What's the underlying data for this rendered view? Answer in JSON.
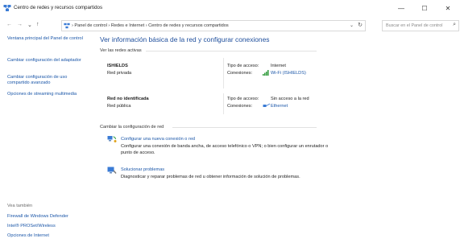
{
  "window": {
    "title": "Centro de redes y recursos compartidos",
    "minimize": "—",
    "maximize": "☐",
    "close": "✕"
  },
  "nav": {
    "back": "←",
    "forward": "→",
    "up": "↑",
    "breadcrumb": "›  Panel de control  ›  Redes e Internet  ›  Centro de redes y recursos compartidos",
    "dropdown": "⌄",
    "refresh": "↻",
    "search_placeholder": "Buscar en el Panel de control",
    "search_icon": "⌕"
  },
  "sidebar": {
    "links": [
      "Ventana principal del Panel de control",
      "Cambiar configuración del adaptador",
      "Cambiar configuración de uso compartido avanzado",
      "Opciones de streaming multimedia"
    ],
    "see_also_title": "Vea también",
    "see_also": [
      "Firewall de Windows Defender",
      "Intel® PROSet/Wireless",
      "Opciones de Internet"
    ]
  },
  "main": {
    "title": "Ver información básica de la red y configurar conexiones",
    "active_label": "Ver las redes activas",
    "networks": [
      {
        "name": "ISHIELDS",
        "type": "Red privada",
        "access_label": "Tipo de acceso:",
        "access_value": "Internet",
        "conn_label": "Conexiones:",
        "conn_value": "Wi-Fi (ISHIELDS)"
      },
      {
        "name": "Red no identificada",
        "type": "Red pública",
        "access_label": "Tipo de acceso:",
        "access_value": "Sin acceso a la red",
        "conn_label": "Conexiones:",
        "conn_value": "Ethernet"
      }
    ],
    "change_label": "Cambiar la configuración de red",
    "tasks": [
      {
        "link": "Configurar una nueva conexión o red",
        "desc": "Configurar una conexión de banda ancha, de acceso telefónico o VPN; o bien configurar un enrutador o punto de acceso."
      },
      {
        "link": "Solucionar problemas",
        "desc": "Diagnosticar y reparar problemas de red u obtener información de solución de problemas."
      }
    ]
  },
  "colors": {
    "link": "#1a56a8",
    "title": "#1e4e9c",
    "wifi_green": "#2e9a3a"
  }
}
